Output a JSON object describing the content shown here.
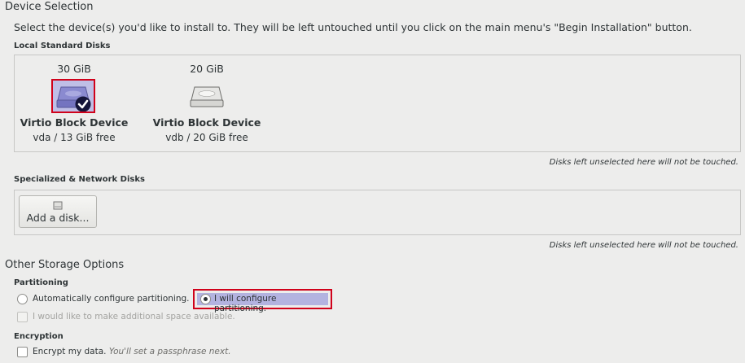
{
  "page": {
    "title": "Device Selection",
    "instructions": "Select the device(s) you'd like to install to.  They will be left untouched until you click on the main menu's \"Begin Installation\" button."
  },
  "local_disks": {
    "label": "Local Standard Disks",
    "disks": [
      {
        "size": "30 GiB",
        "name": "Virtio Block Device",
        "free": "vda  /  13 GiB free",
        "selected": true
      },
      {
        "size": "20 GiB",
        "name": "Virtio Block Device",
        "free": "vdb  /  20 GiB free",
        "selected": false
      }
    ],
    "note": "Disks left unselected here will not be touched."
  },
  "network_disks": {
    "label": "Specialized & Network Disks",
    "add_button": "Add a disk...",
    "note": "Disks left unselected here will not be touched."
  },
  "other": {
    "title": "Other Storage Options",
    "partitioning_label": "Partitioning",
    "auto_label": "Automatically configure partitioning.",
    "manual_label": "I will configure partitioning.",
    "space_label": "I would like to make additional space available.",
    "encryption_label": "Encryption",
    "encrypt_label": "Encrypt my data.",
    "encrypt_hint": "You'll set a passphrase next."
  },
  "colors": {
    "background": "#ededec",
    "selection_highlight": "#b3b3e0",
    "annotation_red": "#d0021b"
  }
}
